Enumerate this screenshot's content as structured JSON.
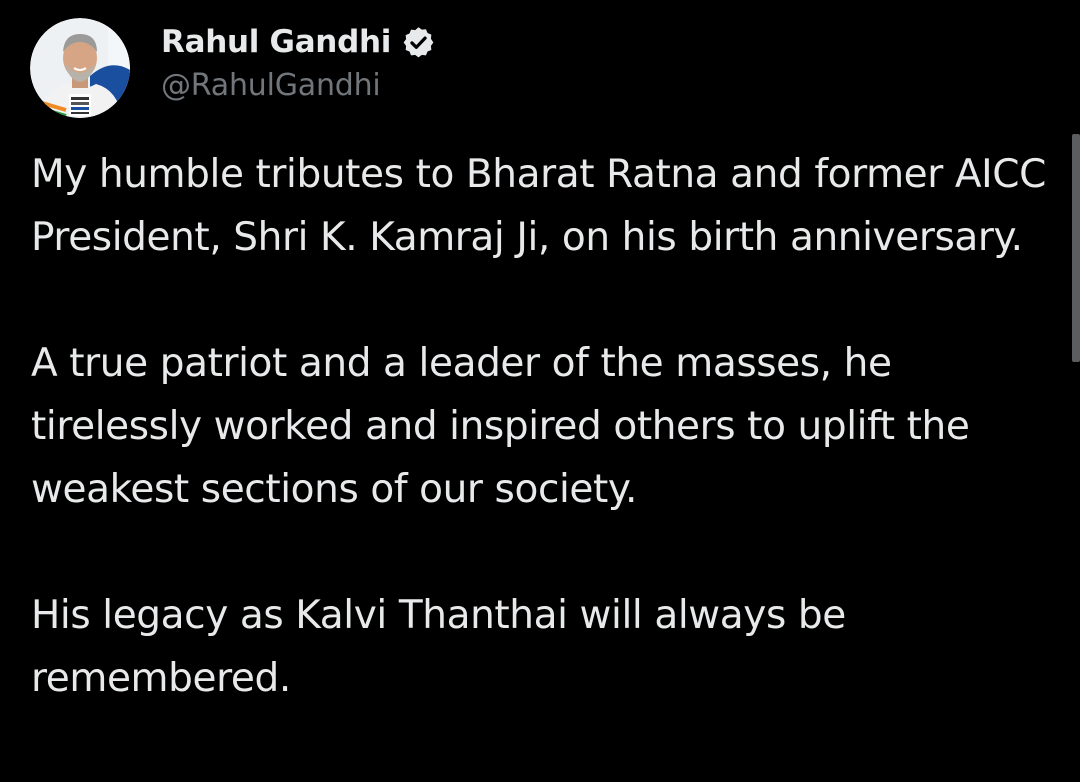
{
  "author": {
    "display_name": "Rahul Gandhi",
    "handle": "@RahulGandhi",
    "verified_icon": "verified-badge-icon",
    "avatar_badge_text": "BHARAT JODO NYAY YATRA"
  },
  "tweet": {
    "paragraphs": [
      "My humble tributes to Bharat Ratna and former AICC President, Shri K. Kamraj Ji, on his birth anniversary.",
      "A true patriot and a leader of the masses, he tirelessly worked and inspired others to uplift the weakest sections of our society.",
      "His legacy as Kalvi Thanthai will always be remembered."
    ]
  },
  "colors": {
    "background": "#000000",
    "text_primary": "#e7e9ea",
    "text_secondary": "#71767b",
    "scrollbar": "#5b5e61"
  }
}
